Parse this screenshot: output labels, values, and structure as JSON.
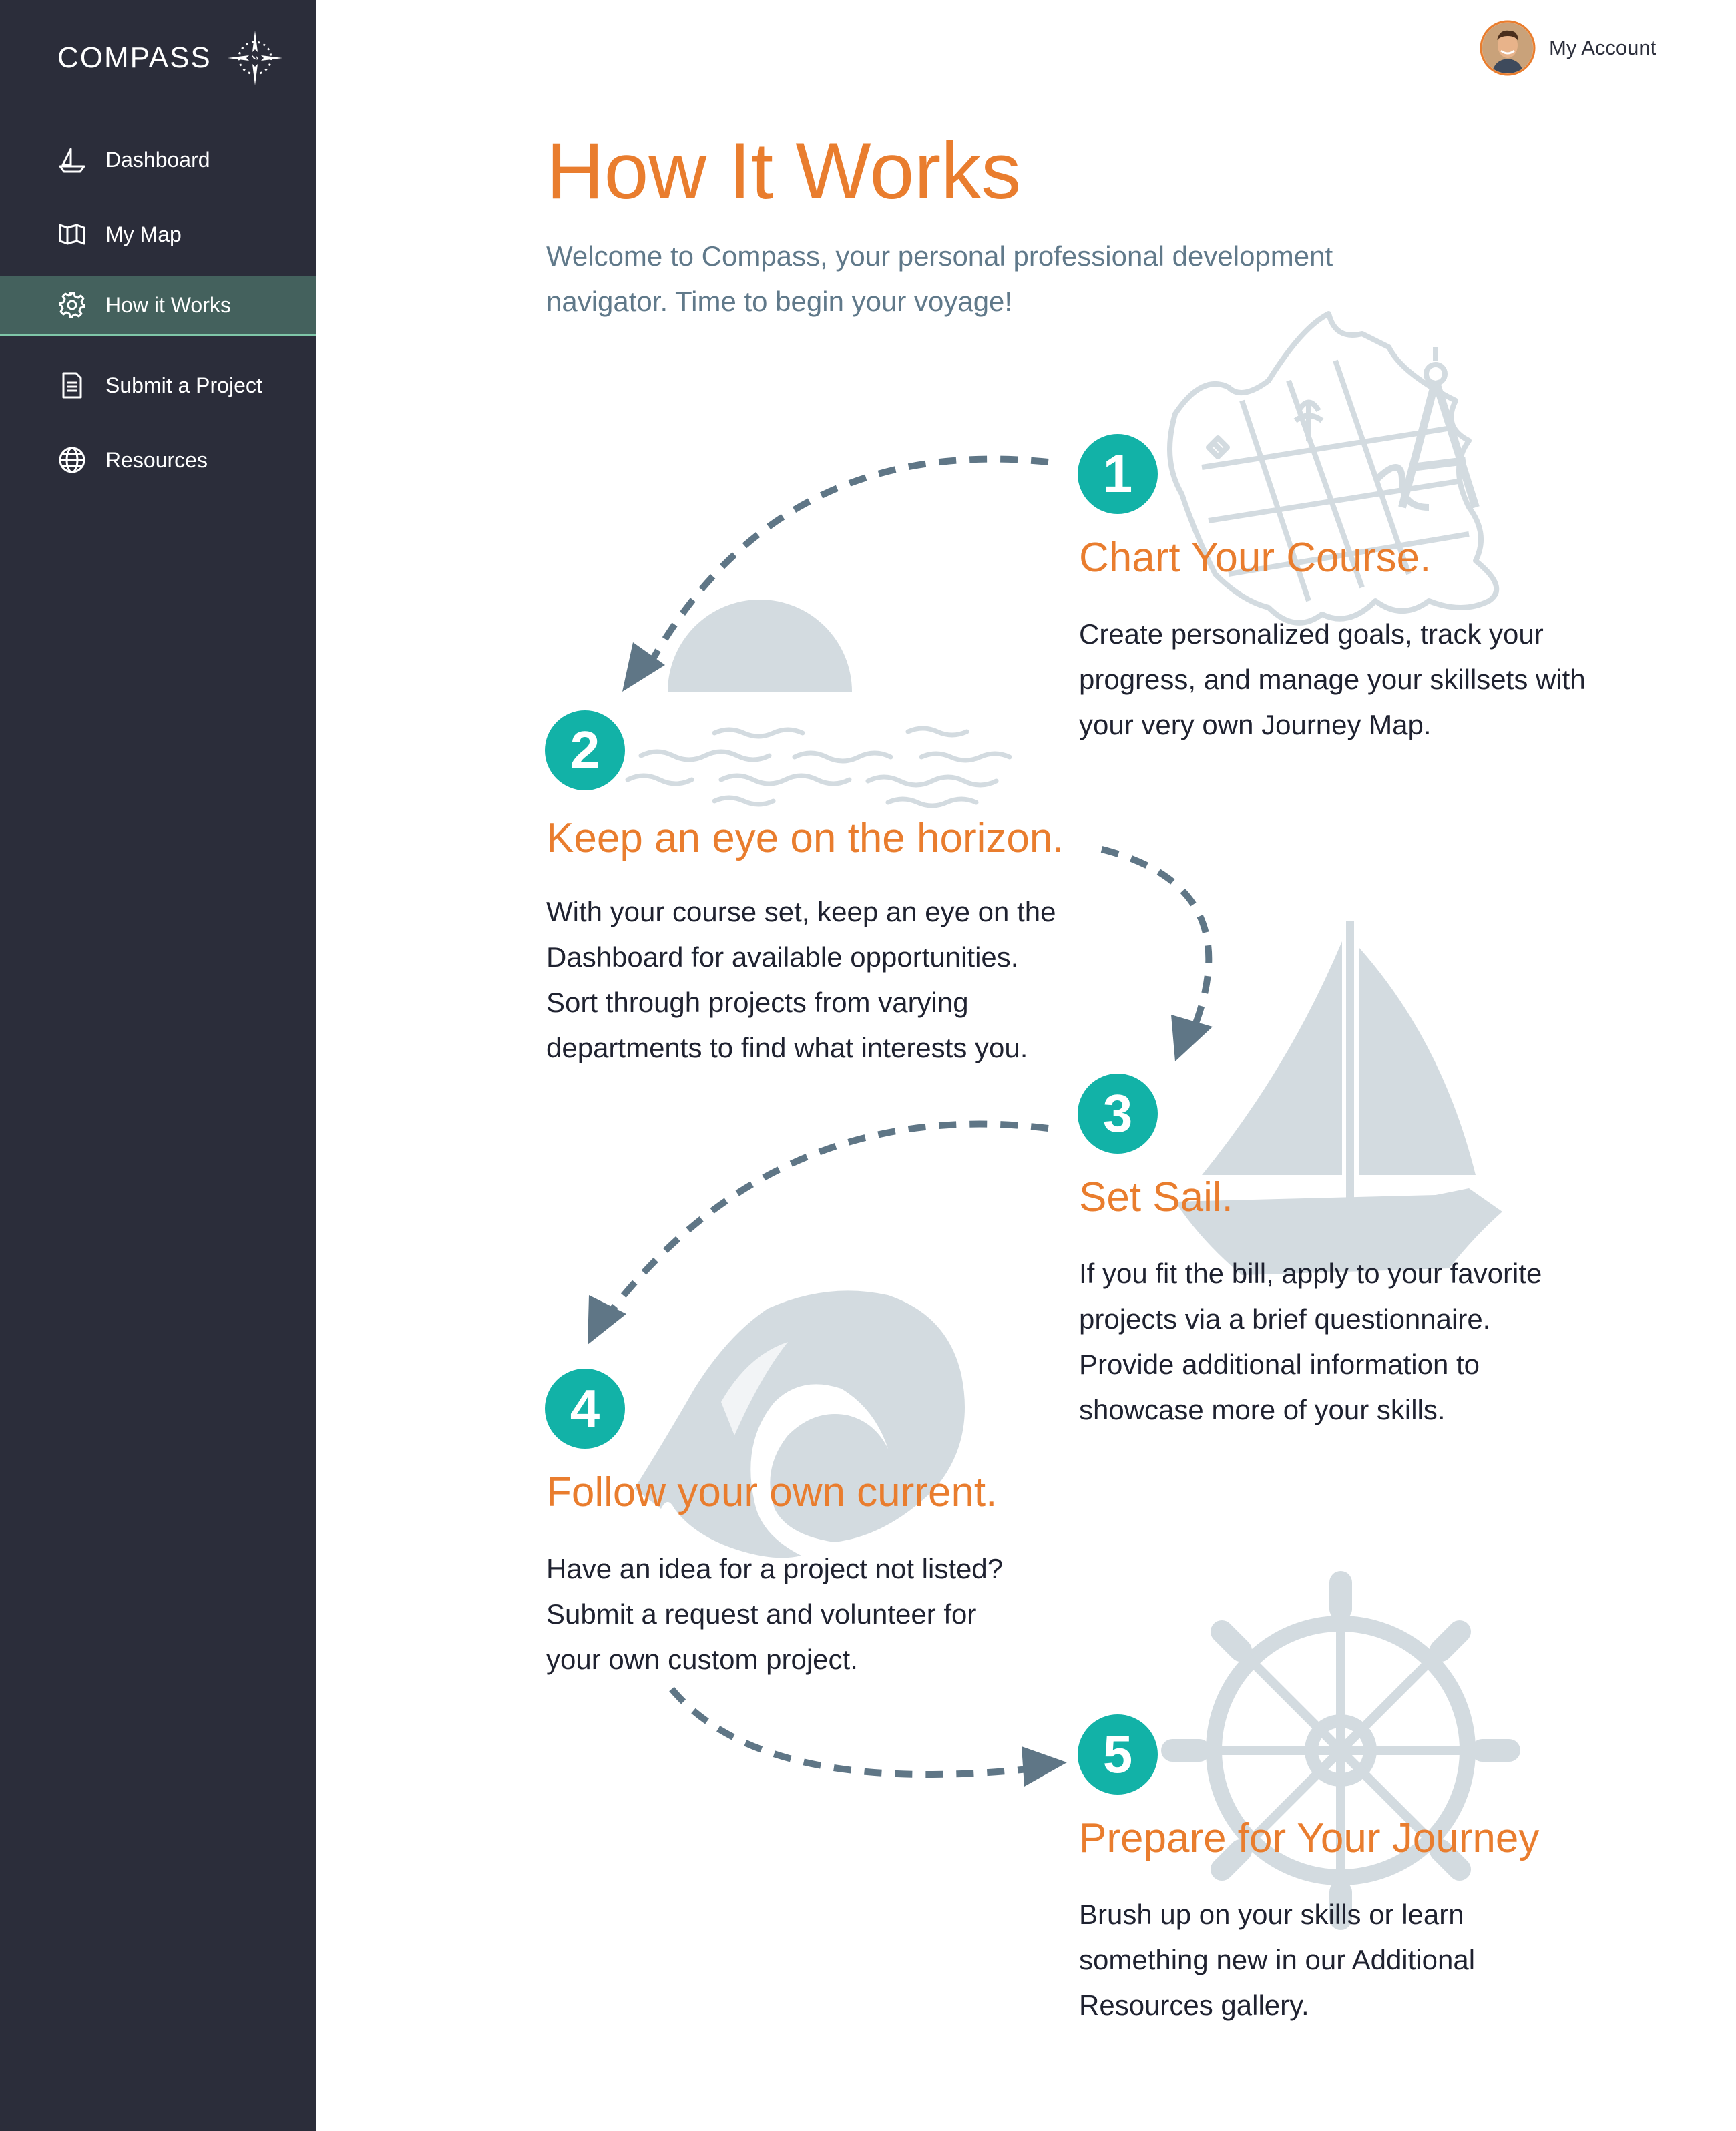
{
  "brand": {
    "name": "COMPASS",
    "logo_icon": "compass-star-icon"
  },
  "sidebar": {
    "items": [
      {
        "label": "Dashboard",
        "icon": "sailboat-icon",
        "active": false
      },
      {
        "label": "My Map",
        "icon": "map-icon",
        "active": false
      },
      {
        "label": "How it Works",
        "icon": "gear-icon",
        "active": true
      },
      {
        "label": "Submit a Project",
        "icon": "document-icon",
        "active": false
      },
      {
        "label": "Resources",
        "icon": "globe-icon",
        "active": false
      }
    ]
  },
  "account": {
    "label": "My Account",
    "avatar_icon": "user-avatar"
  },
  "header": {
    "title": "How It Works",
    "intro_line1": "Welcome to Compass, your personal professional development",
    "intro_line2": "navigator. Time to begin your voyage!"
  },
  "steps": [
    {
      "number": "1",
      "title": "Chart Your Course.",
      "lines": [
        "Create personalized goals, track your",
        "progress, and manage your skillsets with",
        "your very own Journey Map."
      ],
      "illustration": "treasure-map-compass-illustration"
    },
    {
      "number": "2",
      "title": "Keep an eye on the horizon.",
      "lines": [
        "With your course set, keep an eye on the",
        "Dashboard for available opportunities.",
        "Sort through projects from varying",
        "departments to find what interests you."
      ],
      "illustration": "sunset-horizon-illustration"
    },
    {
      "number": "3",
      "title": "Set Sail.",
      "lines": [
        "If you fit the bill, apply to your favorite",
        "projects via a brief questionnaire.",
        "Provide additional information to",
        "showcase more of your skills."
      ],
      "illustration": "sailboat-illustration"
    },
    {
      "number": "4",
      "title": "Follow your own current.",
      "lines": [
        "Have an idea for a project not listed?",
        "Submit a request and volunteer for",
        "your own custom project."
      ],
      "illustration": "wave-illustration"
    },
    {
      "number": "5",
      "title": "Prepare for Your Journey",
      "lines": [
        "Brush up on your skills or learn",
        "something new in our Additional",
        "Resources gallery."
      ],
      "illustration": "ship-wheel-illustration"
    }
  ],
  "colors": {
    "sidebar_bg": "#2b2d3a",
    "active_item_bg": "#44615d",
    "active_underline": "#7fc6a8",
    "accent_orange": "#e97d2e",
    "badge_teal": "#12b2a7",
    "intro_text": "#60798a",
    "arrow": "#5f7686",
    "illustration": "#d3dbe0"
  }
}
